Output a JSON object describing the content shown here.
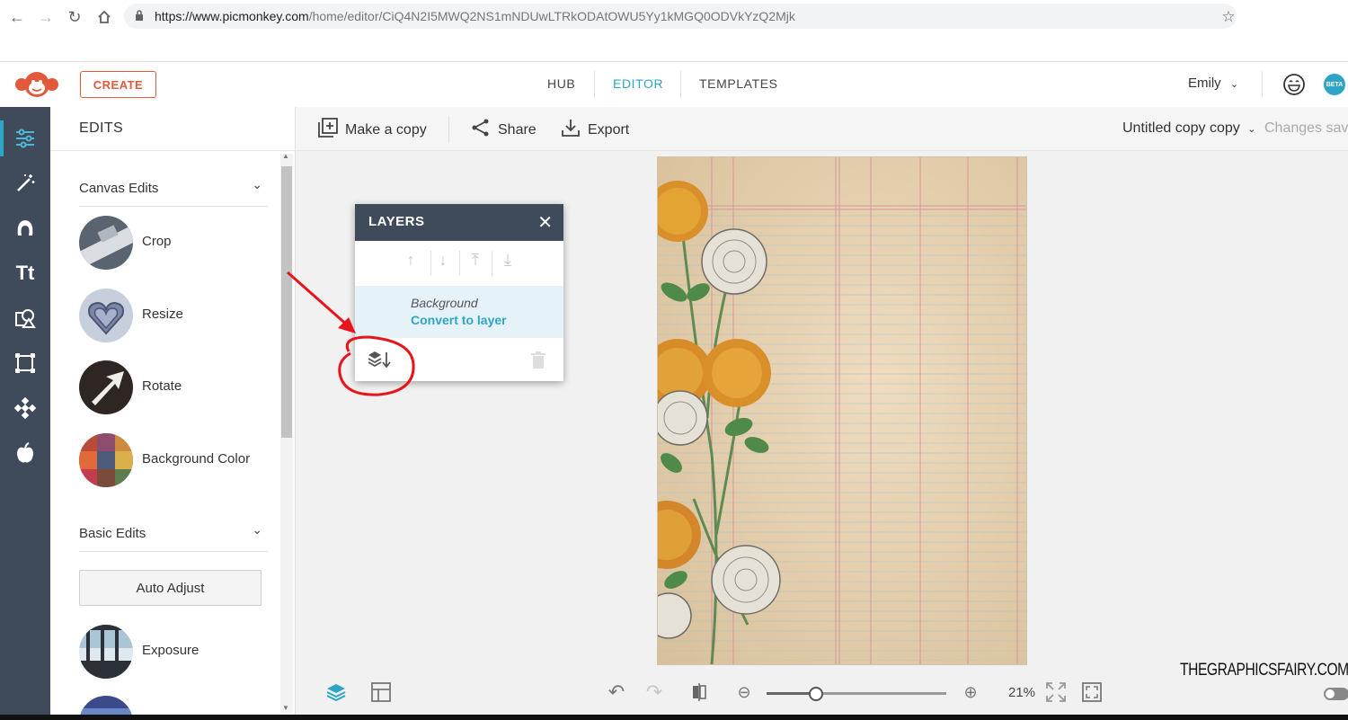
{
  "browser": {
    "url_host": "https://www.picmonkey.com",
    "url_path": "/home/editor/CiQ4N2I5MWQ2NS1mNDUwLTRkODAtOWU5Yy1kMGQ0ODVkYzQ2Mjk"
  },
  "header": {
    "create_label": "CREATE",
    "nav": [
      "HUB",
      "EDITOR",
      "TEMPLATES"
    ],
    "active_nav": "EDITOR",
    "user_name": "Emily",
    "beta_label": "BETA",
    "brand_color": "#e25a3b",
    "accent_color": "#2fa5c6"
  },
  "left_rail": {
    "icons": [
      "sliders-icon",
      "magic-wand-icon",
      "face-touchup-icon",
      "text-icon",
      "graphics-icon",
      "frames-icon",
      "textures-icon",
      "themes-apple-icon"
    ],
    "color": "#3f4b5a"
  },
  "edits": {
    "title": "EDITS",
    "canvas_section": "Canvas Edits",
    "canvas_tools": [
      "Crop",
      "Resize",
      "Rotate",
      "Background Color"
    ],
    "basic_section": "Basic Edits",
    "auto_adjust": "Auto Adjust",
    "basic_tools": [
      "Exposure"
    ]
  },
  "toolbar": {
    "make_copy": "Make a copy",
    "share": "Share",
    "export": "Export",
    "doc_title": "Untitled copy copy",
    "save_status": "Changes save"
  },
  "layers": {
    "title": "LAYERS",
    "layer_name": "Background",
    "convert_label": "Convert to layer"
  },
  "bottom": {
    "zoom_percent": "21%",
    "zoom_fraction": 0.27,
    "watermark": "THEGRAPHICSFAIRY.COM"
  }
}
